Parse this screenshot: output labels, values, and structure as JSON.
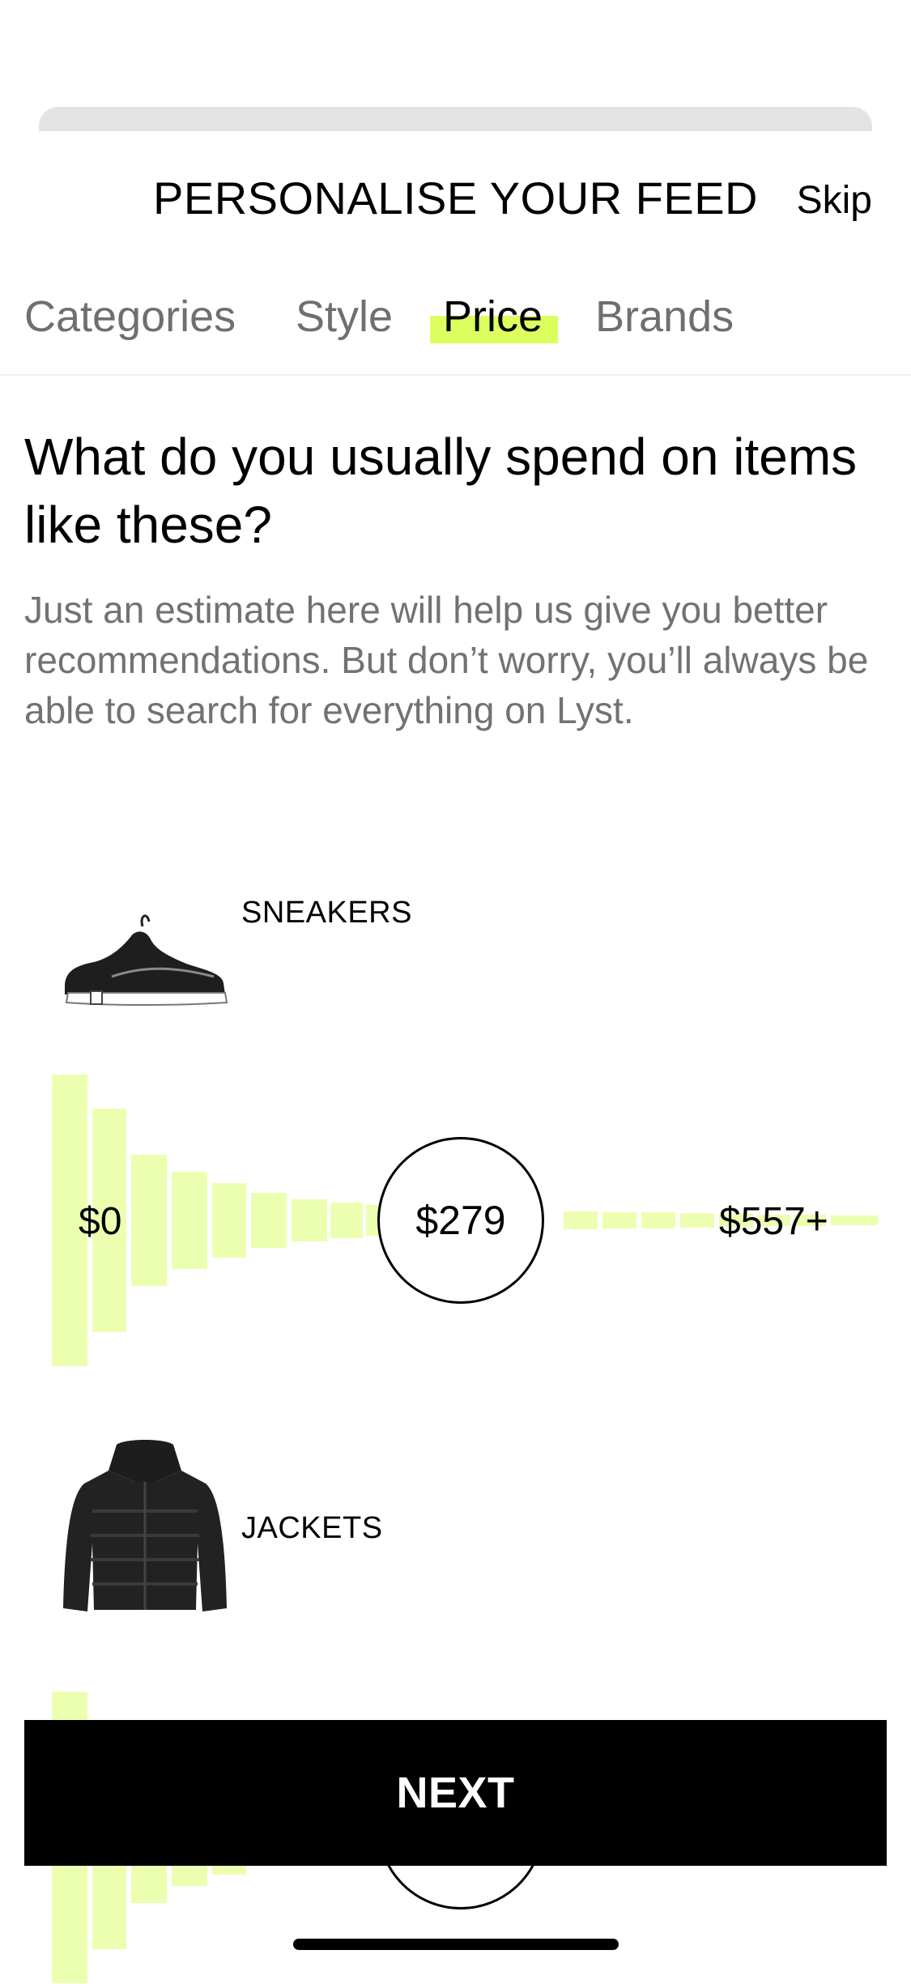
{
  "header": {
    "title": "PERSONALISE YOUR FEED",
    "skip_label": "Skip"
  },
  "tabs": [
    {
      "label": "Categories",
      "active": false
    },
    {
      "label": "Style",
      "active": false
    },
    {
      "label": "Price",
      "active": true
    },
    {
      "label": "Brands",
      "active": false
    }
  ],
  "question": "What do you usually spend on items like these?",
  "description": "Just an estimate here will help us give you better recommendations. But don’t worry, you’ll always be able to search for everything on Lyst.",
  "categories": [
    {
      "label": "SNEAKERS",
      "icon": "sneaker-image",
      "slider": {
        "min_label": "$0",
        "max_label": "$557+",
        "value_label": "$279",
        "value": 279,
        "max": 557
      }
    },
    {
      "label": "JACKETS",
      "icon": "jacket-image",
      "slider": {
        "min_label": "",
        "max_label": "",
        "value_label": "",
        "value": null,
        "max": null
      }
    }
  ],
  "next_label": "NEXT",
  "colors": {
    "accent": "#ddff5e",
    "histogram": "#ecffb0",
    "button": "#000000"
  }
}
